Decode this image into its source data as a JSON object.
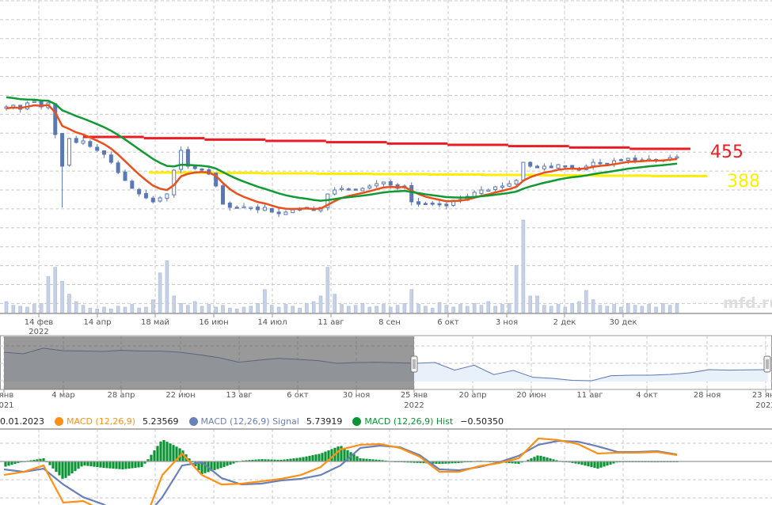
{
  "chart_data": {
    "type": "candlestick",
    "price_panel": {
      "closes": [
        561,
        565,
        555,
        571,
        575,
        561,
        571,
        491,
        411,
        481,
        471,
        475,
        461,
        451,
        441,
        421,
        395,
        375,
        355,
        341,
        331,
        321,
        331,
        341,
        401,
        451,
        411,
        405,
        401,
        391,
        361,
        315,
        307,
        307,
        309,
        307,
        301,
        307,
        295,
        291,
        295,
        301,
        305,
        307,
        299,
        307,
        341,
        351,
        355,
        351,
        351,
        355,
        361,
        367,
        371,
        363,
        355,
        361,
        321,
        315,
        315,
        317,
        315,
        311,
        325,
        327,
        335,
        345,
        351,
        351,
        359,
        361,
        367,
        375,
        421,
        411,
        407,
        411,
        407,
        415,
        411,
        407,
        401,
        411,
        421,
        419,
        417,
        425,
        427,
        431,
        425,
        427,
        429,
        425,
        427,
        433,
        435
      ],
      "volumes": [
        12,
        8,
        7,
        6,
        9,
        10,
        39,
        49,
        34,
        20,
        12,
        8,
        5,
        4,
        6,
        4,
        7,
        6,
        9,
        5,
        6,
        14,
        43,
        56,
        18,
        10,
        8,
        12,
        7,
        9,
        6,
        8,
        5,
        4,
        6,
        7,
        10,
        25,
        8,
        6,
        9,
        7,
        5,
        10,
        12,
        18,
        49,
        20,
        9,
        7,
        8,
        10,
        6,
        7,
        9,
        6,
        8,
        10,
        25,
        9,
        7,
        5,
        11,
        8,
        6,
        9,
        7,
        10,
        8,
        12,
        7,
        9,
        10,
        51,
        100,
        18,
        18,
        8,
        7,
        9,
        6,
        10,
        12,
        24,
        14,
        8,
        7,
        9,
        6,
        10,
        8,
        7,
        9,
        6,
        10,
        8,
        10
      ],
      "moving_averages": [
        {
          "name": "short MA",
          "color": "#e8501e"
        },
        {
          "name": "long MA",
          "color": "#119933"
        }
      ],
      "levels": [
        {
          "label": "455",
          "from": 485,
          "to": 455,
          "color": "#ea1c24"
        },
        {
          "label": "388",
          "from": 395,
          "to": 386,
          "color": "#ffee00"
        }
      ],
      "candle_color": "#5a78b4",
      "volume_color": "#c6d1e6",
      "x_ticks": [
        {
          "label": "14 фев",
          "sub": "2022"
        },
        {
          "label": "14 апр"
        },
        {
          "label": "18 май"
        },
        {
          "label": "16 июн"
        },
        {
          "label": "14 июл"
        },
        {
          "label": "11 авг"
        },
        {
          "label": "8 сен"
        },
        {
          "label": "6 окт"
        },
        {
          "label": "3 ноя"
        },
        {
          "label": "2 дек"
        },
        {
          "label": "30 дек"
        }
      ],
      "watermark": "mfd.ru"
    },
    "navigator": {
      "series": [
        776,
        747,
        850,
        805,
        800,
        790,
        810,
        800,
        795,
        776,
        730,
        675,
        595,
        632,
        665,
        646,
        625,
        574,
        589,
        595,
        585,
        575,
        589,
        450,
        540,
        370,
        445,
        320,
        301,
        265,
        258,
        350,
        358,
        358,
        373,
        402,
        459,
        450,
        455,
        459
      ],
      "x_ticks": [
        {
          "label": "янв",
          "sub": "021"
        },
        {
          "label": "4 мар"
        },
        {
          "label": "28 апр"
        },
        {
          "label": "22 июн"
        },
        {
          "label": "13 авг"
        },
        {
          "label": "6 окт"
        },
        {
          "label": "30 ноя"
        },
        {
          "label": "25 янв",
          "sub": "2022"
        },
        {
          "label": "20 апр"
        },
        {
          "label": "20 июн"
        },
        {
          "label": "11 авг"
        },
        {
          "label": "4 окт"
        },
        {
          "label": "28 ноя"
        },
        {
          "label": "23 янв",
          "sub": "2023"
        }
      ]
    },
    "macd_panel": {
      "date": "0.01.2023",
      "macd": {
        "name": "MACD (12,26,9)",
        "value": "5.23569",
        "color": "#ff9016",
        "values": [
          -11.1,
          -8.5,
          -3.3,
          -33.8,
          -32.5,
          -40.3,
          -50.1,
          -53.3,
          -11.1,
          6.5,
          -11.1,
          -18.9,
          -18.2,
          -16.3,
          -14.3,
          -11.1,
          -4.6,
          9.8,
          13.7,
          14.3,
          11.1,
          3.9,
          -8.5,
          -8.5,
          -3.9,
          -1.3,
          2.6,
          18.9,
          17.6,
          14.3,
          6.5,
          7.2,
          7.2,
          7.8,
          5.24
        ]
      },
      "signal": {
        "name": "MACD (12,26,9) Signal",
        "value": "5.73919",
        "color": "#6a80b8",
        "values": [
          -6.5,
          -8.5,
          -5.9,
          -18.9,
          -29.3,
          -35.1,
          -43.6,
          -48.8,
          -29.3,
          -3.3,
          -0.7,
          -13.7,
          -18.9,
          -18.2,
          -15.6,
          -14.3,
          -11.1,
          -3.3,
          11.1,
          13.0,
          11.7,
          5.2,
          -6.5,
          -7.2,
          -4.6,
          -0.7,
          4.6,
          13.7,
          16.9,
          16.3,
          12.4,
          7.8,
          7.8,
          8.5,
          5.74
        ]
      },
      "hist": {
        "name": "MACD (12,26,9) Hist",
        "value": "−0.50350",
        "color": "#0a9434"
      }
    }
  }
}
